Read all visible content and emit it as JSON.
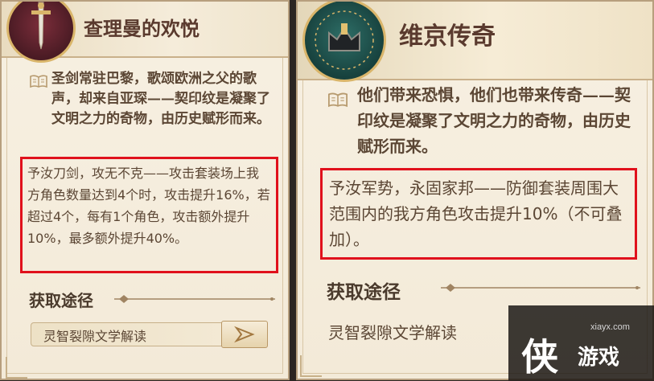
{
  "cards": [
    {
      "title": "查理曼的欢悦",
      "emblem_icon": "sword-emblem-icon",
      "description": "圣剑常驻巴黎，歌颂欧洲之父的歌声，却来自亚琛——契印纹是凝聚了文明之力的奇物，由历史赋形而来。",
      "effect": "予汝刀剑，攻无不克——攻击套装场上我方角色数量达到4个时，攻击提升16%，若超过4个，每有1个角色，攻击额外提升10%，最多额外提升40%。",
      "source_heading": "获取途径",
      "source": "灵智裂隙文学解读"
    },
    {
      "title": "维京传奇",
      "emblem_icon": "crown-emblem-icon",
      "description": "他们带来恐惧，他们也带来传奇——契印纹是凝聚了文明之力的奇物，由历史赋形而来。",
      "effect": "予汝军势，永固家邦——防御套装周围大范围内的我方角色攻击提升10%（不可叠加）。",
      "source_heading": "获取途径",
      "source": "灵智裂隙文学解读"
    }
  ],
  "watermark": {
    "url": "xiayx.com",
    "big_char": "侠",
    "small_text": "游戏"
  },
  "colors": {
    "highlight_border": "#e0111c",
    "text_brown": "#5b4634",
    "card_bg": "#f5ecdc"
  }
}
